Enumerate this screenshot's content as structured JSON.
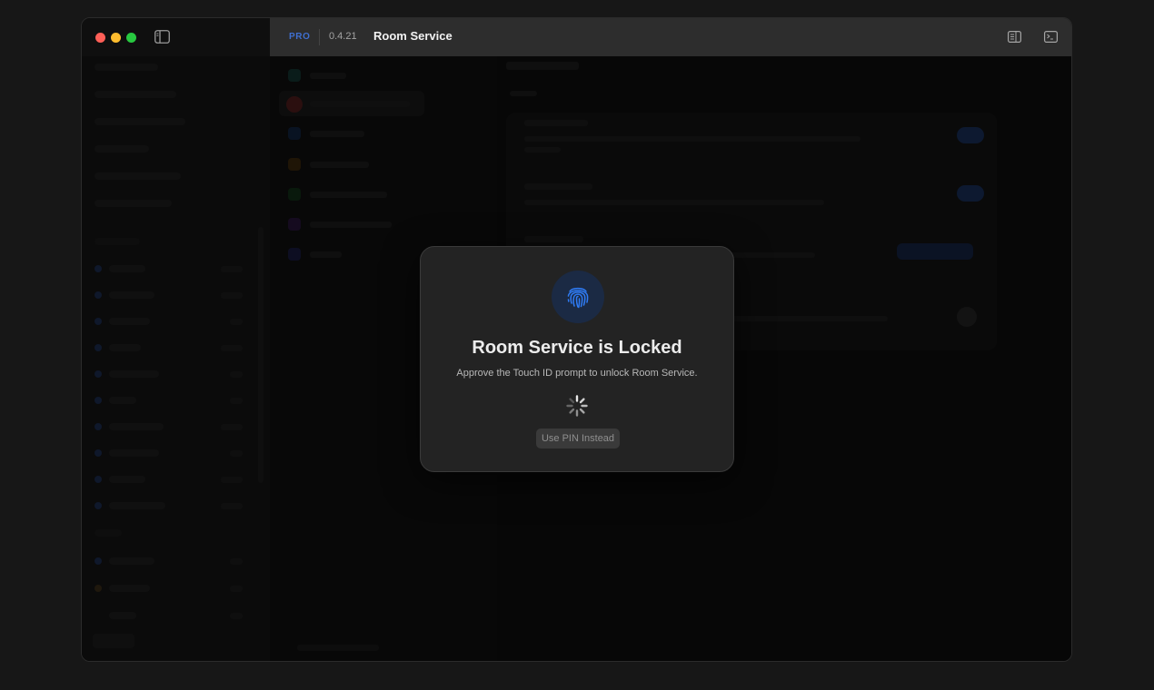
{
  "titlebar": {
    "badge": "PRO",
    "version": "0.4.21",
    "title": "Room Service"
  },
  "lock_dialog": {
    "title": "Room Service is Locked",
    "subtitle": "Approve the Touch ID prompt to unlock Room Service.",
    "pin_button_label": "Use PIN Instead"
  },
  "icons": {
    "fingerprint": "fingerprint-icon",
    "spinner": "loading-spinner-icon",
    "sidebar_toggle": "sidebar-toggle-icon",
    "inspector": "inspector-panel-icon",
    "terminal": "terminal-icon"
  },
  "colors": {
    "accent": "#3f6fd0",
    "fingerprint": "#2f7cf6",
    "traffic_red": "#fe5f57",
    "traffic_yellow": "#febc2e",
    "traffic_green": "#28c840"
  }
}
